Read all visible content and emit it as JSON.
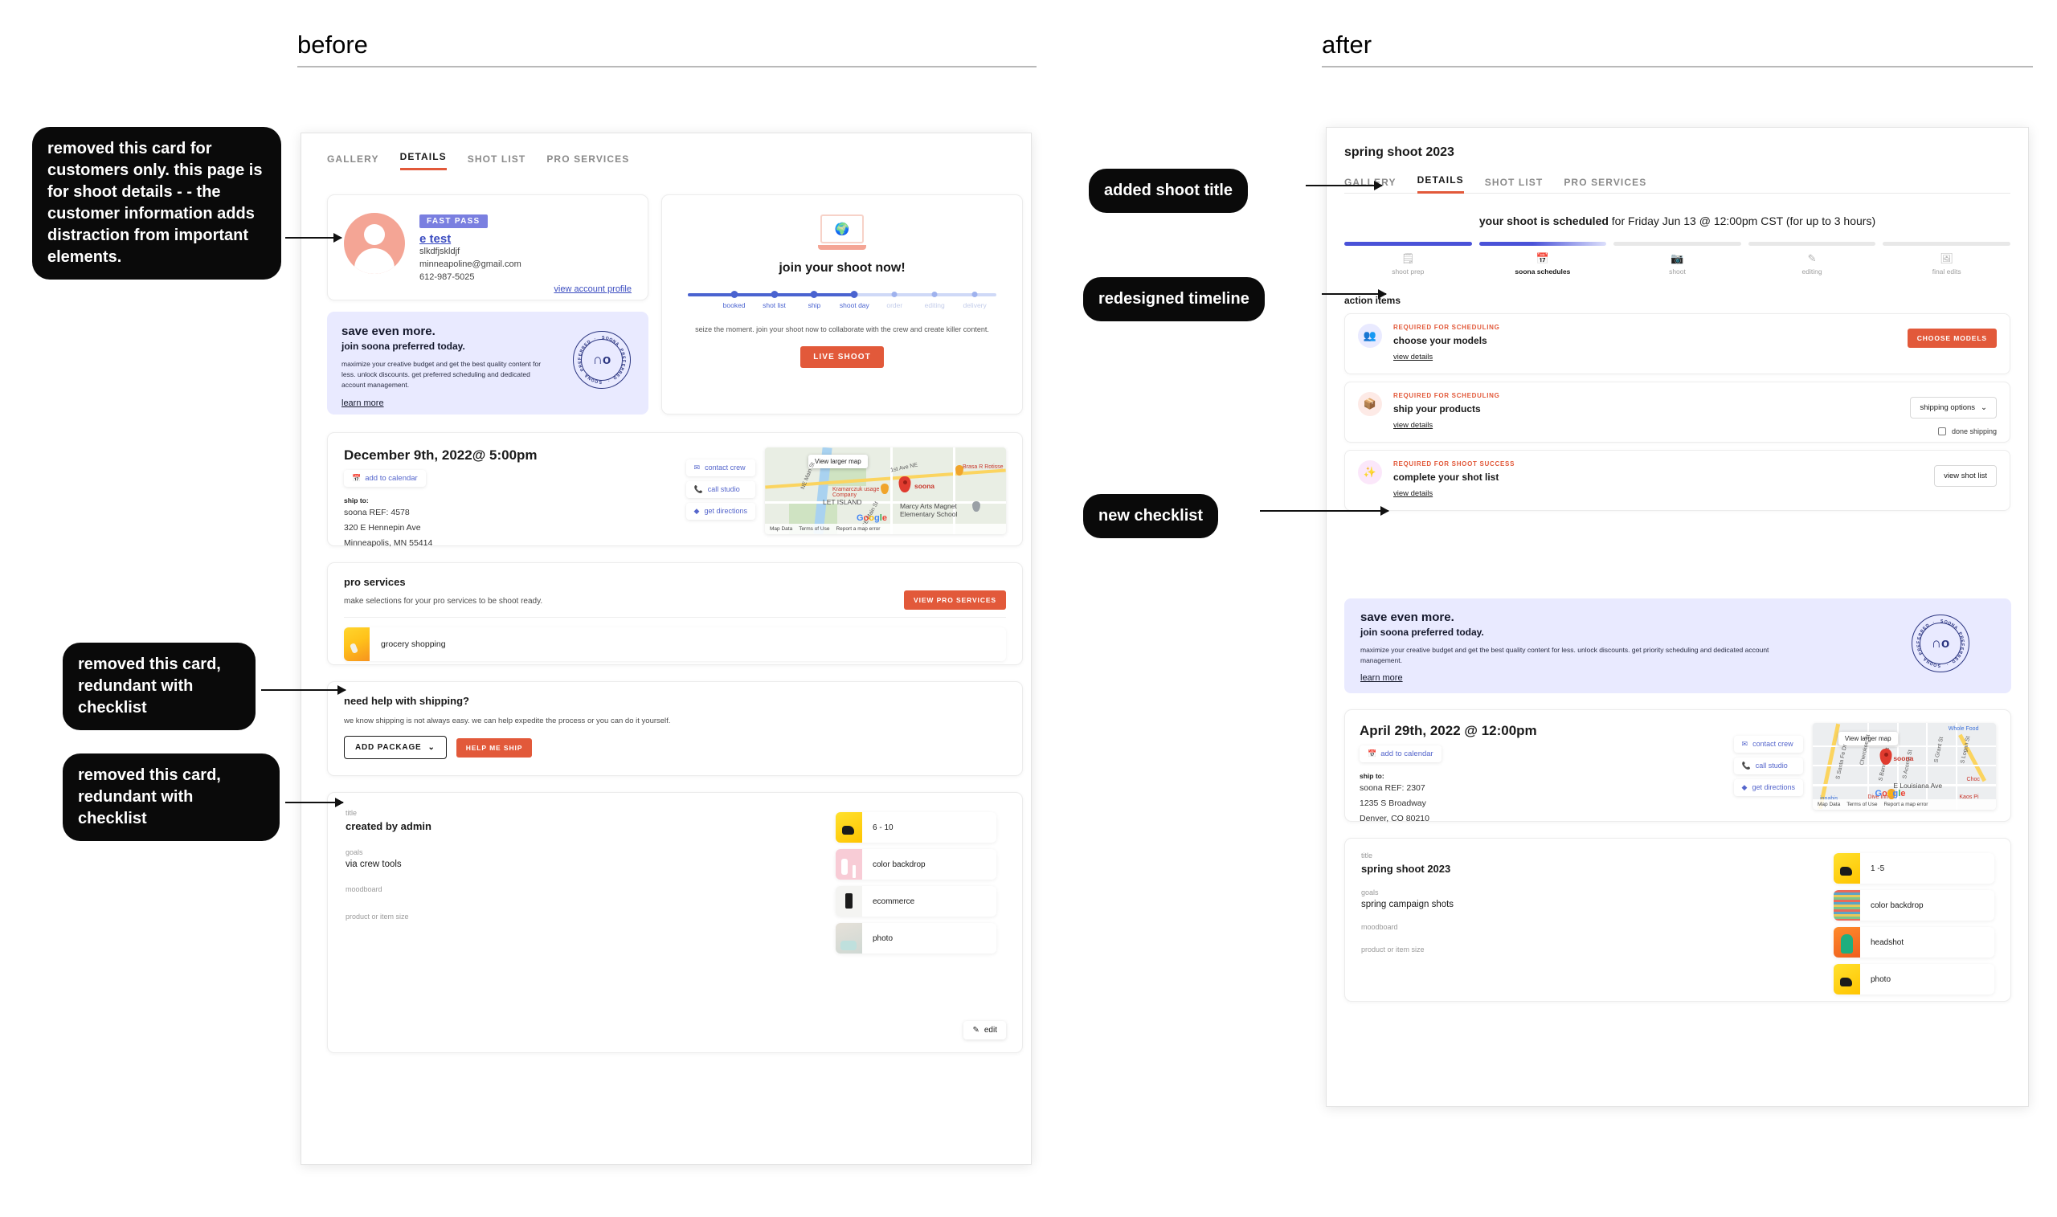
{
  "sections": {
    "before": "before",
    "after": "after"
  },
  "annotations": [
    {
      "id": "a1",
      "text": "removed this card for customers only. this page is for shoot details - - the customer information adds distraction from important elements."
    },
    {
      "id": "a2",
      "text": "removed this card, redundant with checklist"
    },
    {
      "id": "a3",
      "text": "removed this card, redundant with checklist"
    },
    {
      "id": "a4",
      "text": "added shoot title"
    },
    {
      "id": "a5",
      "text": "redesigned timeline"
    },
    {
      "id": "a6",
      "text": "new checklist"
    }
  ],
  "before": {
    "tabs": [
      {
        "label": "GALLERY",
        "active": false
      },
      {
        "label": "DETAILS",
        "active": true
      },
      {
        "label": "SHOT LIST",
        "active": false
      },
      {
        "label": "PRO SERVICES",
        "active": false
      }
    ],
    "profile": {
      "badge": "FAST PASS",
      "name": "e test",
      "company": "slkdfjskldjf",
      "email": "minneapoline@gmail.com",
      "phone": "612-987-5025",
      "link": "view account profile"
    },
    "save_card": {
      "heading": "save even more.",
      "subheading": "join soona preferred today.",
      "body": "maximize your creative budget and get the best quality content for less. unlock discounts. get preferred scheduling and dedicated account management.",
      "link": "learn more",
      "seal_top": "SOONA PREFERRED",
      "seal_bottom": "SOONA PREFERRED"
    },
    "join_card": {
      "title": "join your shoot now!",
      "timeline": [
        {
          "label": "booked",
          "done": true
        },
        {
          "label": "shot list",
          "done": true
        },
        {
          "label": "ship",
          "done": true
        },
        {
          "label": "shoot day",
          "done": true
        },
        {
          "label": "order",
          "done": false
        },
        {
          "label": "editing",
          "done": false
        },
        {
          "label": "delivery",
          "done": false
        }
      ],
      "subtitle": "seize the moment. join your shoot now to collaborate with the crew and create killer content.",
      "button": "LIVE SHOOT"
    },
    "date_card": {
      "date": "December 9th, 2022@ 5:00pm",
      "calendar_chip": "add to calendar",
      "ship_to_label": "ship to:",
      "ref": "soona REF: 4578",
      "street": "320 E Hennepin Ave",
      "city": "Minneapolis, MN 55414",
      "actions": [
        "contact crew",
        "call studio",
        "get directions"
      ],
      "map": {
        "view_larger": "View larger map",
        "pin_label": "soona",
        "brand": "Google",
        "footer": [
          "Map Data",
          "Terms of Use",
          "Report a map error"
        ],
        "labels": [
          "NE Main St",
          "1st Ave NE",
          "Brasa R Rotisse",
          "Kramarczuk usage Company",
          "LET ISLAND",
          "Marcy Arts Magnet Elementary School",
          "SE Main St"
        ]
      }
    },
    "pro_services": {
      "heading": "pro services",
      "body": "make selections for your pro services to be shoot ready.",
      "button": "VIEW PRO SERVICES",
      "items": [
        "grocery shopping"
      ]
    },
    "shipping": {
      "heading": "need help with shipping?",
      "body": "we know shipping is not always easy. we can help expedite the process or you can do it yourself.",
      "add_package": "ADD PACKAGE",
      "help_me_ship": "HELP ME SHIP"
    },
    "details": {
      "title_label": "title",
      "title_value": "created by admin",
      "goals_label": "goals",
      "goals_value": "via crew tools",
      "moodboard_label": "moodboard",
      "size_label": "product or item size",
      "edit": "edit",
      "tiles": [
        {
          "label": "6 - 10",
          "thumb": "yellow"
        },
        {
          "label": "color backdrop",
          "thumb": "pink"
        },
        {
          "label": "ecommerce",
          "thumb": "white"
        },
        {
          "label": "photo",
          "thumb": "gray"
        }
      ]
    }
  },
  "after": {
    "shoot_title": "spring shoot 2023",
    "tabs": [
      {
        "label": "GALLERY",
        "active": false
      },
      {
        "label": "DETAILS",
        "active": true
      },
      {
        "label": "SHOT LIST",
        "active": false
      },
      {
        "label": "PRO SERVICES",
        "active": false
      }
    ],
    "scheduled_bold": "your shoot is scheduled",
    "scheduled_rest": " for Friday Jun 13 @ 12:00pm CST (for up to 3 hours)",
    "timeline": [
      {
        "label": "shoot prep",
        "state": "done",
        "icon": "clipboard"
      },
      {
        "label": "soona schedules",
        "state": "current",
        "icon": "calendar"
      },
      {
        "label": "shoot",
        "state": "todo",
        "icon": "camera"
      },
      {
        "label": "editing",
        "state": "todo",
        "icon": "edit"
      },
      {
        "label": "final edits",
        "state": "todo",
        "icon": "gallery"
      }
    ],
    "action_items_heading": "action items",
    "action_items": [
      {
        "tag": "REQUIRED FOR SCHEDULING",
        "title": "choose your models",
        "link": "view details",
        "button": "CHOOSE MODELS",
        "button_style": "orange",
        "icon_color": "blue"
      },
      {
        "tag": "REQUIRED FOR SCHEDULING",
        "title": "ship your products",
        "link": "view details",
        "button": "shipping options",
        "button_style": "ghost-caret",
        "checkbox": "done shipping",
        "icon_color": "red"
      },
      {
        "tag": "REQUIRED FOR SHOOT SUCCESS",
        "title": "complete your shot list",
        "link": "view details",
        "button": "view shot list",
        "button_style": "ghost",
        "icon_color": "pink"
      }
    ],
    "save_card": {
      "heading": "save even more.",
      "subheading": "join soona preferred today.",
      "body": "maximize your creative budget and get the best quality content for less. unlock discounts. get priority scheduling and dedicated account management.",
      "link": "learn more",
      "seal_top": "SOONA PREFERRED",
      "seal_bottom": "SOONA PREFERRED"
    },
    "date_card": {
      "date": "April 29th, 2022 @ 12:00pm",
      "calendar_chip": "add to calendar",
      "ship_to_label": "ship to:",
      "ref": "soona REF: 2307",
      "street": "1235 S Broadway",
      "city": "Denver, CO 80210",
      "actions": [
        "contact crew",
        "call studio",
        "get directions"
      ],
      "map": {
        "view_larger": "View larger map",
        "pin_label": "soona",
        "brand": "Google",
        "footer": [
          "Map Data",
          "Terms of Use",
          "Report a map error"
        ],
        "labels": [
          "Whole Food",
          "S Santa Fe Dr",
          "S Bannock St",
          "S Acoma St",
          "S Grant St",
          "S Logan St",
          "E Louisiana Ave",
          "Dive Inn",
          "Kaos Pi",
          "Choc",
          "innabis",
          "Cherokee St"
        ]
      }
    },
    "details": {
      "title_label": "title",
      "title_value": "spring shoot 2023",
      "goals_label": "goals",
      "goals_value": "spring campaign shots",
      "moodboard_label": "moodboard",
      "size_label": "product or item size",
      "tiles": [
        {
          "label": "1 -5",
          "thumb": "yellow"
        },
        {
          "label": "color backdrop",
          "thumb": "stripes"
        },
        {
          "label": "headshot",
          "thumb": "orange"
        },
        {
          "label": "photo",
          "thumb": "yellow"
        }
      ]
    }
  }
}
